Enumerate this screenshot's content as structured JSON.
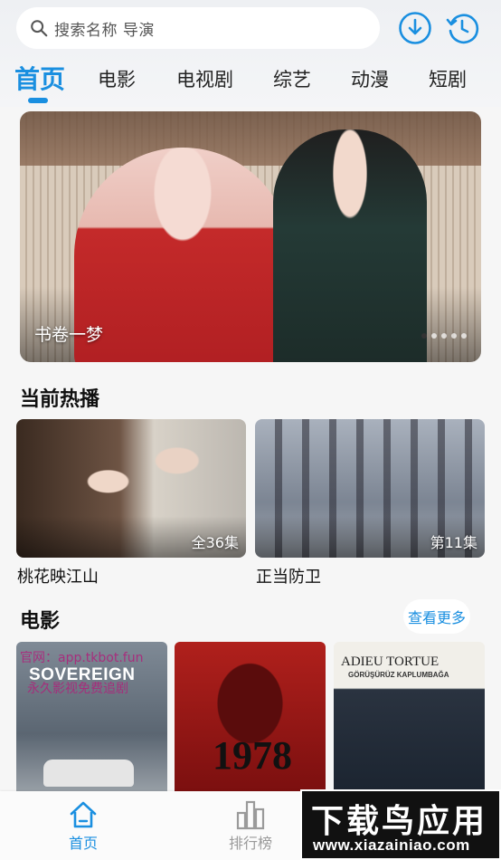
{
  "header": {
    "search_placeholder": "搜索名称 导演",
    "download_icon": "download-circle-icon",
    "history_icon": "history-clock-icon"
  },
  "tabs": [
    {
      "label": "首页",
      "active": true
    },
    {
      "label": "电影",
      "active": false
    },
    {
      "label": "电视剧",
      "active": false
    },
    {
      "label": "综艺",
      "active": false
    },
    {
      "label": "动漫",
      "active": false
    },
    {
      "label": "短剧",
      "active": false
    }
  ],
  "banner": {
    "title": "书卷一梦",
    "dots": 5,
    "active_dot": 1
  },
  "hot_section": {
    "title": "当前热播",
    "items": [
      {
        "title": "桃花映江山",
        "episodes": "全36集"
      },
      {
        "title": "正当防卫",
        "episodes": "第11集"
      }
    ]
  },
  "movie_section": {
    "title": "电影",
    "more_label": "查看更多",
    "posters": [
      {
        "text": "SOVEREIGN"
      },
      {
        "text": "1978"
      },
      {
        "text": "ADIEU TORTUE",
        "subtext": "GÖRÜŞÜRÜZ KAPLUMBAĞA"
      }
    ],
    "watermark_line1": "官网：app.tkbot.fun",
    "watermark_line2": "永久影视免费追剧"
  },
  "bottom_nav": [
    {
      "label": "首页",
      "icon": "home-icon",
      "active": true
    },
    {
      "label": "排行榜",
      "icon": "ranking-bars-icon",
      "active": false
    }
  ],
  "watermark_badge": {
    "line1": "下载鸟应用",
    "line2": "www.xiazainiao.com"
  },
  "colors": {
    "accent": "#1a8fe0",
    "background": "#f6f6f6"
  }
}
